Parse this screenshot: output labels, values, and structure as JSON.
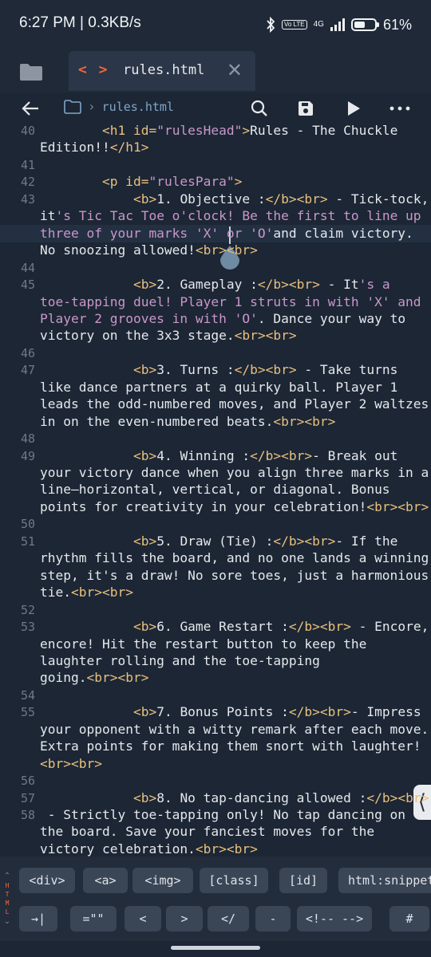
{
  "status": {
    "time": "6:27 PM | 0.3KB/s",
    "volte": "Vo LTE",
    "network": "4G",
    "battery": "61%",
    "battery_level": 0.61
  },
  "tab": {
    "code_icon": "< >",
    "title": "rules.html",
    "close": "✕"
  },
  "toolbar": {
    "back_icon": "back-arrow-icon",
    "breadcrumb": "rules.html",
    "search_icon": "search-icon",
    "save_icon": "save-icon",
    "run_icon": "play-icon",
    "more_icon": "more-icon"
  },
  "editor": {
    "rows": [
      {
        "num": "40",
        "parts": [
          [
            "t",
            "        "
          ],
          [
            "tag",
            "<h1 id="
          ],
          [
            "str",
            "\"rulesHead\""
          ],
          [
            "tag",
            ">"
          ],
          [
            "text",
            "Rules - The Chuckle"
          ]
        ]
      },
      {
        "num": "",
        "parts": [
          [
            "text",
            "Edition!!"
          ],
          [
            "tag",
            "</h1>"
          ]
        ]
      },
      {
        "num": "41",
        "parts": []
      },
      {
        "num": "42",
        "parts": [
          [
            "t",
            "        "
          ],
          [
            "tag",
            "<p id="
          ],
          [
            "str",
            "\"rulesPara\""
          ],
          [
            "tag",
            ">"
          ]
        ]
      },
      {
        "num": "43",
        "parts": [
          [
            "t",
            "            "
          ],
          [
            "tag",
            "<b>"
          ],
          [
            "text",
            "1. Objective :"
          ],
          [
            "tag",
            "</b><br>"
          ],
          [
            "text",
            " - Tick-tock,"
          ]
        ]
      },
      {
        "num": "",
        "parts": [
          [
            "text",
            "it"
          ],
          [
            "str",
            "'s Tic Tac Toe o'clock! Be the first to line up"
          ]
        ]
      },
      {
        "num": "",
        "parts": [
          [
            "str",
            "three of your marks 'X' or 'O'"
          ],
          [
            "text",
            "and claim victory."
          ]
        ]
      },
      {
        "num": "",
        "parts": [
          [
            "text",
            "No snoozing allowed!"
          ],
          [
            "tag",
            "<br><br>"
          ]
        ]
      },
      {
        "num": "44",
        "parts": []
      },
      {
        "num": "45",
        "parts": [
          [
            "t",
            "            "
          ],
          [
            "tag",
            "<b>"
          ],
          [
            "text",
            "2. Gameplay :"
          ],
          [
            "tag",
            "</b><br>"
          ],
          [
            "text",
            " - It"
          ],
          [
            "str",
            "'s a"
          ]
        ]
      },
      {
        "num": "",
        "parts": [
          [
            "str",
            "toe-tapping duel! Player 1 struts in with 'X' and"
          ]
        ]
      },
      {
        "num": "",
        "parts": [
          [
            "str",
            "Player 2 grooves in with 'O'"
          ],
          [
            "text",
            ". Dance your way to"
          ]
        ]
      },
      {
        "num": "",
        "parts": [
          [
            "text",
            "victory on the 3x3 stage."
          ],
          [
            "tag",
            "<br><br>"
          ]
        ]
      },
      {
        "num": "46",
        "parts": []
      },
      {
        "num": "47",
        "parts": [
          [
            "t",
            "            "
          ],
          [
            "tag",
            "<b>"
          ],
          [
            "text",
            "3. Turns :"
          ],
          [
            "tag",
            "</b><br>"
          ],
          [
            "text",
            " - Take turns"
          ]
        ]
      },
      {
        "num": "",
        "parts": [
          [
            "text",
            "like dance partners at a quirky ball. Player 1"
          ]
        ]
      },
      {
        "num": "",
        "parts": [
          [
            "text",
            "leads the odd-numbered moves, and Player 2 waltzes"
          ]
        ]
      },
      {
        "num": "",
        "parts": [
          [
            "text",
            "in on the even-numbered beats."
          ],
          [
            "tag",
            "<br><br>"
          ]
        ]
      },
      {
        "num": "48",
        "parts": []
      },
      {
        "num": "49",
        "parts": [
          [
            "t",
            "            "
          ],
          [
            "tag",
            "<b>"
          ],
          [
            "text",
            "4. Winning :"
          ],
          [
            "tag",
            "</b><br>"
          ],
          [
            "text",
            "- Break out"
          ]
        ]
      },
      {
        "num": "",
        "parts": [
          [
            "text",
            "your victory dance when you align three marks in a"
          ]
        ]
      },
      {
        "num": "",
        "parts": [
          [
            "text",
            "line—horizontal, vertical, or diagonal. Bonus"
          ]
        ]
      },
      {
        "num": "",
        "parts": [
          [
            "text",
            "points for creativity in your celebration!"
          ],
          [
            "tag",
            "<br><br>"
          ]
        ]
      },
      {
        "num": "50",
        "parts": []
      },
      {
        "num": "51",
        "parts": [
          [
            "t",
            "            "
          ],
          [
            "tag",
            "<b>"
          ],
          [
            "text",
            "5. Draw (Tie) :"
          ],
          [
            "tag",
            "</b><br>"
          ],
          [
            "text",
            "- If the"
          ]
        ]
      },
      {
        "num": "",
        "parts": [
          [
            "text",
            "rhythm fills the board, and no one lands a winning"
          ]
        ]
      },
      {
        "num": "",
        "parts": [
          [
            "text",
            "step, it's a draw! No sore toes, just a harmonious"
          ]
        ]
      },
      {
        "num": "",
        "parts": [
          [
            "text",
            "tie."
          ],
          [
            "tag",
            "<br><br>"
          ]
        ]
      },
      {
        "num": "52",
        "parts": []
      },
      {
        "num": "53",
        "parts": [
          [
            "t",
            "            "
          ],
          [
            "tag",
            "<b>"
          ],
          [
            "text",
            "6. Game Restart :"
          ],
          [
            "tag",
            "</b><br>"
          ],
          [
            "text",
            " - Encore,"
          ]
        ]
      },
      {
        "num": "",
        "parts": [
          [
            "text",
            "encore! Hit the restart button to keep the"
          ]
        ]
      },
      {
        "num": "",
        "parts": [
          [
            "text",
            "laughter rolling and the toe-tapping"
          ]
        ]
      },
      {
        "num": "",
        "parts": [
          [
            "text",
            "going."
          ],
          [
            "tag",
            "<br><br>"
          ]
        ]
      },
      {
        "num": "54",
        "parts": []
      },
      {
        "num": "55",
        "parts": [
          [
            "t",
            "            "
          ],
          [
            "tag",
            "<b>"
          ],
          [
            "text",
            "7. Bonus Points :"
          ],
          [
            "tag",
            "</b><br>"
          ],
          [
            "text",
            "- Impress"
          ]
        ]
      },
      {
        "num": "",
        "parts": [
          [
            "text",
            "your opponent with a witty remark after each move."
          ]
        ]
      },
      {
        "num": "",
        "parts": [
          [
            "text",
            "Extra points for making them snort with laughter!"
          ]
        ]
      },
      {
        "num": "",
        "parts": [
          [
            "tag",
            "<br><br>"
          ]
        ]
      },
      {
        "num": "56",
        "parts": []
      },
      {
        "num": "57",
        "parts": [
          [
            "t",
            "            "
          ],
          [
            "tag",
            "<b>"
          ],
          [
            "text",
            "8. No tap-dancing allowed :"
          ],
          [
            "tag",
            "</b><br>"
          ]
        ]
      },
      {
        "num": "58",
        "parts": [
          [
            "text",
            " - Strictly toe-tapping only! No tap dancing on"
          ]
        ]
      },
      {
        "num": "",
        "parts": [
          [
            "text",
            "the board. Save your fanciest moves for the"
          ]
        ]
      },
      {
        "num": "",
        "parts": [
          [
            "text",
            "victory celebration."
          ],
          [
            "tag",
            "<br><br>"
          ]
        ]
      }
    ]
  },
  "accessory": {
    "side_label": [
      "H",
      "T",
      "M",
      "L"
    ],
    "row1": [
      "<div>",
      "<a>",
      "<img>",
      "[class]",
      "[id]",
      "html:snippet"
    ],
    "row2": [
      "→|",
      "=\"\"",
      "<",
      ">",
      "</",
      "-",
      "<!-- -->",
      "#"
    ]
  },
  "colors": {
    "bg": "#1c2635",
    "tag": "#e8c07d",
    "string": "#c997c9",
    "text": "#e6e8eb",
    "accent": "#f0683c"
  }
}
